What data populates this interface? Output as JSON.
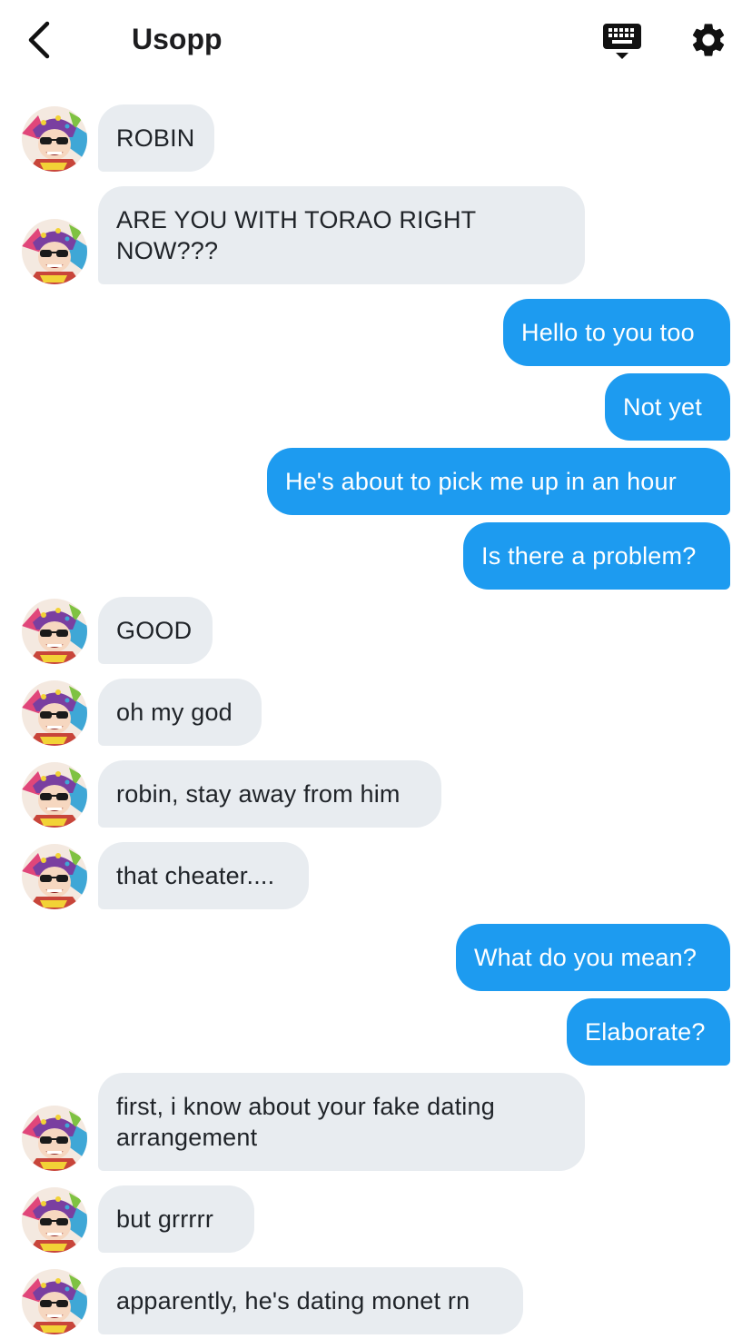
{
  "header": {
    "title": "Usopp",
    "back_icon": "chevron-left-icon",
    "keyboard_icon": "keyboard-icon",
    "settings_icon": "gear-icon"
  },
  "colors": {
    "incoming_bubble": "#e8ecf0",
    "outgoing_bubble": "#1d9bf0"
  },
  "messages": [
    {
      "from": "Usopp",
      "text": "ROBIN"
    },
    {
      "from": "Usopp",
      "text": "ARE YOU WITH TORAO RIGHT NOW???"
    },
    {
      "from": "me",
      "text": "Hello to you too"
    },
    {
      "from": "me",
      "text": "Not yet"
    },
    {
      "from": "me",
      "text": "He's about to pick me up in an hour"
    },
    {
      "from": "me",
      "text": "Is there a problem?"
    },
    {
      "from": "Usopp",
      "text": "GOOD"
    },
    {
      "from": "Usopp",
      "text": "oh my god"
    },
    {
      "from": "Usopp",
      "text": "robin, stay away from him"
    },
    {
      "from": "Usopp",
      "text": "that cheater...."
    },
    {
      "from": "me",
      "text": "What do you mean?"
    },
    {
      "from": "me",
      "text": "Elaborate?"
    },
    {
      "from": "Usopp",
      "text": "first, i know about your fake dating arrangement"
    },
    {
      "from": "Usopp",
      "text": "but grrrrr"
    },
    {
      "from": "Usopp",
      "text": "apparently, he's dating monet rn"
    }
  ]
}
